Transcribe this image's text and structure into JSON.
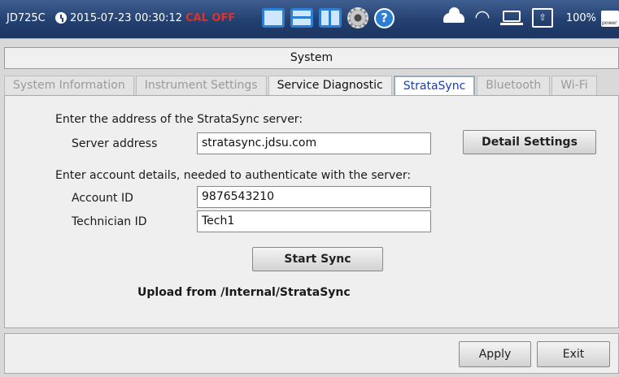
{
  "status_bar": {
    "model": "JD725C",
    "datetime": "2015-07-23 00:30:12",
    "cal_status": "CAL OFF",
    "battery_percent": "100%",
    "battery_label": "power",
    "accent_color": "#2d7fd6",
    "icons": [
      "clock-icon",
      "single-screen-icon",
      "split-horizontal-icon",
      "split-vertical-icon",
      "gear-icon",
      "help-icon",
      "cloud-icon",
      "wifi-icon",
      "laptop-icon",
      "usb-icon",
      "battery-icon"
    ]
  },
  "window": {
    "title": "System"
  },
  "tabs": [
    {
      "label": "System Information"
    },
    {
      "label": "Instrument Settings"
    },
    {
      "label": "Service Diagnostic"
    },
    {
      "label": "StrataSync"
    },
    {
      "label": "Bluetooth"
    },
    {
      "label": "Wi-Fi"
    }
  ],
  "active_tab": "StrataSync",
  "form": {
    "server_prompt": "Enter the address of the StrataSync server:",
    "server_label": "Server address",
    "server_value": "stratasync.jdsu.com",
    "detail_settings_label": "Detail Settings",
    "account_prompt": "Enter account details, needed to authenticate with the server:",
    "account_label": "Account ID",
    "account_value": "9876543210",
    "tech_label": "Technician ID",
    "tech_value": "Tech1",
    "start_sync_label": "Start Sync",
    "upload_text": "Upload from /Internal/StrataSync"
  },
  "footer": {
    "apply_label": "Apply",
    "exit_label": "Exit"
  }
}
